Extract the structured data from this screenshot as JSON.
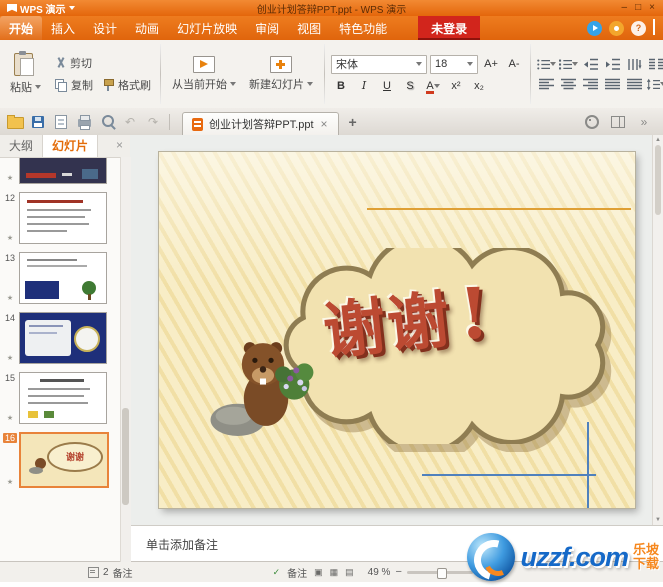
{
  "titlebar": {
    "logo": "WPS 演示",
    "title": "创业计划答辩PPT.ppt - WPS 演示",
    "minimize": "–",
    "restore": "□",
    "close": "×"
  },
  "tabs": {
    "items": [
      "开始",
      "插入",
      "设计",
      "动画",
      "幻灯片放映",
      "审阅",
      "视图",
      "特色功能"
    ],
    "login": "未登录"
  },
  "ribbon": {
    "paste": "粘贴",
    "cut": "剪切",
    "copy": "复制",
    "format_painter": "格式刷",
    "from_current": "从当前开始",
    "new_slide": "新建幻灯片",
    "font_name": "宋体",
    "font_size": "18",
    "grow_font": "A+",
    "shrink_font": "A-",
    "bold": "B",
    "italic": "I",
    "underline": "U",
    "shadow": "S",
    "font_color": "A",
    "superscript": "x²",
    "subscript": "x₂"
  },
  "docbar": {
    "tab_title": "创业计划答辩PPT.ppt",
    "close_tab": "×",
    "new_tab": "+"
  },
  "sidebar": {
    "outline_tab": "大纲",
    "slides_tab": "幻灯片",
    "close": "×",
    "thumbs": [
      {
        "num": "12"
      },
      {
        "num": "13"
      },
      {
        "num": "14"
      },
      {
        "num": "15"
      },
      {
        "num": "16"
      }
    ]
  },
  "slide": {
    "thanks": "谢谢",
    "exclamation": "!"
  },
  "notes": {
    "placeholder": "单击添加备注"
  },
  "statusbar": {
    "info_count": "2",
    "info_label": "备注",
    "notes_button": "备注",
    "zoom_value": "49 %",
    "zoom_out": "−",
    "zoom_in": "+"
  },
  "watermark": {
    "site": "uzzf.com",
    "cn_line1": "乐坡",
    "cn_line2": "下载"
  },
  "icons": {
    "help": "?",
    "undo": "↶",
    "redo": "↷",
    "star": "★",
    "check": "✓",
    "view_normal": "▣",
    "view_sorter": "▦",
    "view_read": "▤",
    "scroll_up": "▲",
    "scroll_down": "▼",
    "more": "»"
  },
  "colors": {
    "accent_orange": "#e8690f",
    "login_red": "#d2251c",
    "slide_cream": "#f7ecc6",
    "thanks_red": "#bc4a32",
    "guide_blue": "#4f81bd"
  }
}
